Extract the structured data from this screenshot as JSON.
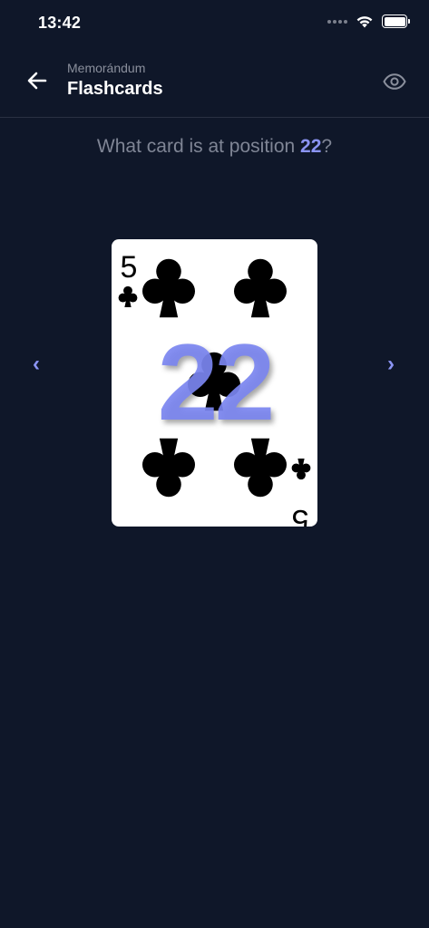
{
  "status_bar": {
    "time": "13:42",
    "icons": [
      "signal-icon",
      "wifi-icon",
      "battery-icon"
    ]
  },
  "header": {
    "subtitle": "Memorándum",
    "title": "Flashcards",
    "back_icon": "arrow-left-icon",
    "visibility_icon": "eye-icon"
  },
  "question": {
    "prefix": "What card is at position ",
    "position": "22",
    "suffix": "?"
  },
  "navigation": {
    "prev": "‹",
    "next": "›"
  },
  "card": {
    "rank": "5",
    "suit": "clubs",
    "suit_symbol": "♣",
    "overlay_number": "22"
  },
  "colors": {
    "background": "#0f1729",
    "accent": "#8b94f3",
    "muted_text": "#7f8595",
    "divider": "#2a3142"
  }
}
